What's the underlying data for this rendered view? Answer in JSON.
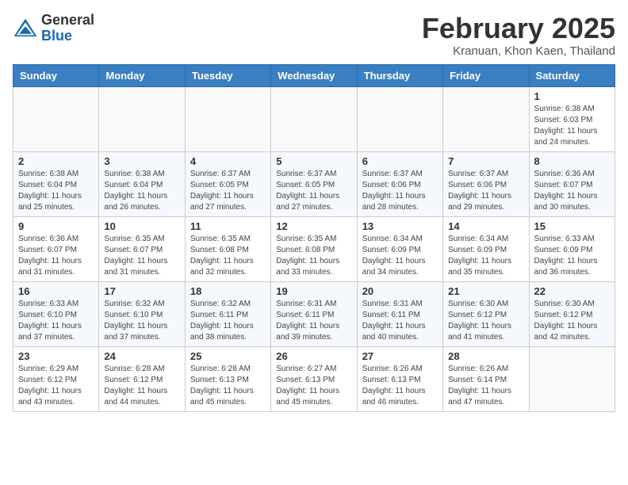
{
  "logo": {
    "general": "General",
    "blue": "Blue"
  },
  "header": {
    "month": "February 2025",
    "location": "Kranuan, Khon Kaen, Thailand"
  },
  "weekdays": [
    "Sunday",
    "Monday",
    "Tuesday",
    "Wednesday",
    "Thursday",
    "Friday",
    "Saturday"
  ],
  "weeks": [
    [
      {
        "day": "",
        "sunrise": "",
        "sunset": "",
        "daylight": ""
      },
      {
        "day": "",
        "sunrise": "",
        "sunset": "",
        "daylight": ""
      },
      {
        "day": "",
        "sunrise": "",
        "sunset": "",
        "daylight": ""
      },
      {
        "day": "",
        "sunrise": "",
        "sunset": "",
        "daylight": ""
      },
      {
        "day": "",
        "sunrise": "",
        "sunset": "",
        "daylight": ""
      },
      {
        "day": "",
        "sunrise": "",
        "sunset": "",
        "daylight": ""
      },
      {
        "day": "1",
        "sunrise": "Sunrise: 6:38 AM",
        "sunset": "Sunset: 6:03 PM",
        "daylight": "Daylight: 11 hours and 24 minutes."
      }
    ],
    [
      {
        "day": "2",
        "sunrise": "Sunrise: 6:38 AM",
        "sunset": "Sunset: 6:04 PM",
        "daylight": "Daylight: 11 hours and 25 minutes."
      },
      {
        "day": "3",
        "sunrise": "Sunrise: 6:38 AM",
        "sunset": "Sunset: 6:04 PM",
        "daylight": "Daylight: 11 hours and 26 minutes."
      },
      {
        "day": "4",
        "sunrise": "Sunrise: 6:37 AM",
        "sunset": "Sunset: 6:05 PM",
        "daylight": "Daylight: 11 hours and 27 minutes."
      },
      {
        "day": "5",
        "sunrise": "Sunrise: 6:37 AM",
        "sunset": "Sunset: 6:05 PM",
        "daylight": "Daylight: 11 hours and 27 minutes."
      },
      {
        "day": "6",
        "sunrise": "Sunrise: 6:37 AM",
        "sunset": "Sunset: 6:06 PM",
        "daylight": "Daylight: 11 hours and 28 minutes."
      },
      {
        "day": "7",
        "sunrise": "Sunrise: 6:37 AM",
        "sunset": "Sunset: 6:06 PM",
        "daylight": "Daylight: 11 hours and 29 minutes."
      },
      {
        "day": "8",
        "sunrise": "Sunrise: 6:36 AM",
        "sunset": "Sunset: 6:07 PM",
        "daylight": "Daylight: 11 hours and 30 minutes."
      }
    ],
    [
      {
        "day": "9",
        "sunrise": "Sunrise: 6:36 AM",
        "sunset": "Sunset: 6:07 PM",
        "daylight": "Daylight: 11 hours and 31 minutes."
      },
      {
        "day": "10",
        "sunrise": "Sunrise: 6:35 AM",
        "sunset": "Sunset: 6:07 PM",
        "daylight": "Daylight: 11 hours and 31 minutes."
      },
      {
        "day": "11",
        "sunrise": "Sunrise: 6:35 AM",
        "sunset": "Sunset: 6:08 PM",
        "daylight": "Daylight: 11 hours and 32 minutes."
      },
      {
        "day": "12",
        "sunrise": "Sunrise: 6:35 AM",
        "sunset": "Sunset: 6:08 PM",
        "daylight": "Daylight: 11 hours and 33 minutes."
      },
      {
        "day": "13",
        "sunrise": "Sunrise: 6:34 AM",
        "sunset": "Sunset: 6:09 PM",
        "daylight": "Daylight: 11 hours and 34 minutes."
      },
      {
        "day": "14",
        "sunrise": "Sunrise: 6:34 AM",
        "sunset": "Sunset: 6:09 PM",
        "daylight": "Daylight: 11 hours and 35 minutes."
      },
      {
        "day": "15",
        "sunrise": "Sunrise: 6:33 AM",
        "sunset": "Sunset: 6:09 PM",
        "daylight": "Daylight: 11 hours and 36 minutes."
      }
    ],
    [
      {
        "day": "16",
        "sunrise": "Sunrise: 6:33 AM",
        "sunset": "Sunset: 6:10 PM",
        "daylight": "Daylight: 11 hours and 37 minutes."
      },
      {
        "day": "17",
        "sunrise": "Sunrise: 6:32 AM",
        "sunset": "Sunset: 6:10 PM",
        "daylight": "Daylight: 11 hours and 37 minutes."
      },
      {
        "day": "18",
        "sunrise": "Sunrise: 6:32 AM",
        "sunset": "Sunset: 6:11 PM",
        "daylight": "Daylight: 11 hours and 38 minutes."
      },
      {
        "day": "19",
        "sunrise": "Sunrise: 6:31 AM",
        "sunset": "Sunset: 6:11 PM",
        "daylight": "Daylight: 11 hours and 39 minutes."
      },
      {
        "day": "20",
        "sunrise": "Sunrise: 6:31 AM",
        "sunset": "Sunset: 6:11 PM",
        "daylight": "Daylight: 11 hours and 40 minutes."
      },
      {
        "day": "21",
        "sunrise": "Sunrise: 6:30 AM",
        "sunset": "Sunset: 6:12 PM",
        "daylight": "Daylight: 11 hours and 41 minutes."
      },
      {
        "day": "22",
        "sunrise": "Sunrise: 6:30 AM",
        "sunset": "Sunset: 6:12 PM",
        "daylight": "Daylight: 11 hours and 42 minutes."
      }
    ],
    [
      {
        "day": "23",
        "sunrise": "Sunrise: 6:29 AM",
        "sunset": "Sunset: 6:12 PM",
        "daylight": "Daylight: 11 hours and 43 minutes."
      },
      {
        "day": "24",
        "sunrise": "Sunrise: 6:28 AM",
        "sunset": "Sunset: 6:12 PM",
        "daylight": "Daylight: 11 hours and 44 minutes."
      },
      {
        "day": "25",
        "sunrise": "Sunrise: 6:28 AM",
        "sunset": "Sunset: 6:13 PM",
        "daylight": "Daylight: 11 hours and 45 minutes."
      },
      {
        "day": "26",
        "sunrise": "Sunrise: 6:27 AM",
        "sunset": "Sunset: 6:13 PM",
        "daylight": "Daylight: 11 hours and 45 minutes."
      },
      {
        "day": "27",
        "sunrise": "Sunrise: 6:26 AM",
        "sunset": "Sunset: 6:13 PM",
        "daylight": "Daylight: 11 hours and 46 minutes."
      },
      {
        "day": "28",
        "sunrise": "Sunrise: 6:26 AM",
        "sunset": "Sunset: 6:14 PM",
        "daylight": "Daylight: 11 hours and 47 minutes."
      },
      {
        "day": "",
        "sunrise": "",
        "sunset": "",
        "daylight": ""
      }
    ]
  ]
}
